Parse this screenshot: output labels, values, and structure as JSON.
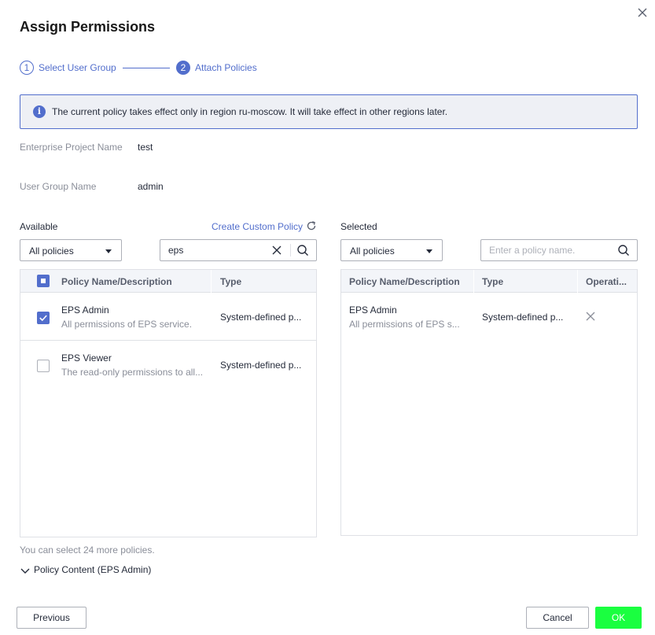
{
  "dialog": {
    "title": "Assign Permissions"
  },
  "steps": [
    {
      "number": "1",
      "label": "Select User Group"
    },
    {
      "number": "2",
      "label": "Attach Policies"
    }
  ],
  "alert": {
    "icon": "info-icon",
    "text": "The current policy takes effect only in region ru-moscow. It will take effect in other regions later."
  },
  "fields": {
    "enterprise_project": {
      "label": "Enterprise Project Name",
      "value": "test"
    },
    "user_group": {
      "label": "User Group Name",
      "value": "admin"
    }
  },
  "available": {
    "label": "Available",
    "create_link": "Create Custom Policy",
    "filter_value": "All policies",
    "search_value": "eps",
    "columns": [
      "Policy Name/Description",
      "Type"
    ],
    "rows": [
      {
        "name": "EPS Admin",
        "description": "All permissions of EPS service.",
        "type": "System-defined p...",
        "checked": true
      },
      {
        "name": "EPS Viewer",
        "description": "The read-only permissions to all...",
        "type": "System-defined p...",
        "checked": false
      }
    ]
  },
  "selected": {
    "label": "Selected",
    "filter_value": "All policies",
    "search_placeholder": "Enter a policy name.",
    "columns": [
      "Policy Name/Description",
      "Type",
      "Operati..."
    ],
    "rows": [
      {
        "name": "EPS Admin",
        "description": "All permissions of EPS s...",
        "type": "System-defined p..."
      }
    ]
  },
  "hint": "You can select 24 more policies.",
  "policy_content": "Policy Content (EPS Admin)",
  "footer": {
    "previous": "Previous",
    "cancel": "Cancel",
    "ok": "OK"
  },
  "colors": {
    "accent": "#526ecc",
    "ok_button": "#1aff40"
  }
}
